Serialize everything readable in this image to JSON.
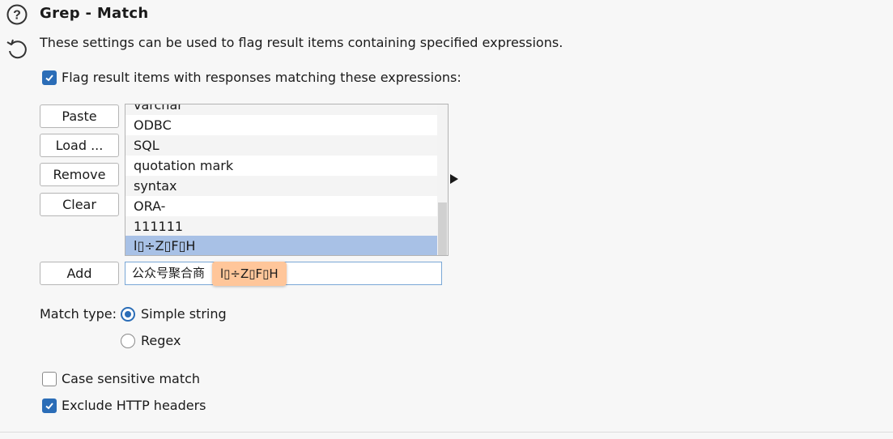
{
  "section": {
    "title": "Grep - Match",
    "description": "These settings can be used to flag result items containing specified expressions."
  },
  "flag_checkbox": {
    "label": "Flag result items with responses matching these expressions:",
    "checked": true
  },
  "buttons": {
    "paste": "Paste",
    "load": "Load ...",
    "remove": "Remove",
    "clear": "Clear",
    "add": "Add"
  },
  "expressions": [
    "varchar",
    "ODBC",
    "SQL",
    "quotation mark",
    "syntax",
    "ORA-",
    "111111",
    "l▯÷Z▯F▯H"
  ],
  "selected_index": 7,
  "new_expression_input": {
    "value": "公众号聚合商"
  },
  "tooltip": {
    "text": "l▯÷Z▯F▯H"
  },
  "match_type": {
    "label": "Match type:",
    "options": [
      "Simple string",
      "Regex"
    ],
    "selected": "Simple string"
  },
  "case_sensitive": {
    "label": "Case sensitive match",
    "checked": false
  },
  "exclude_headers": {
    "label": "Exclude HTTP headers",
    "checked": true
  },
  "colors": {
    "accent": "#2b6db7",
    "selection": "#a8c1e6",
    "tooltip_bg": "#ffc69a"
  },
  "icons": [
    "help-icon",
    "revert-icon",
    "checkmark-icon",
    "expand-arrow-icon"
  ]
}
